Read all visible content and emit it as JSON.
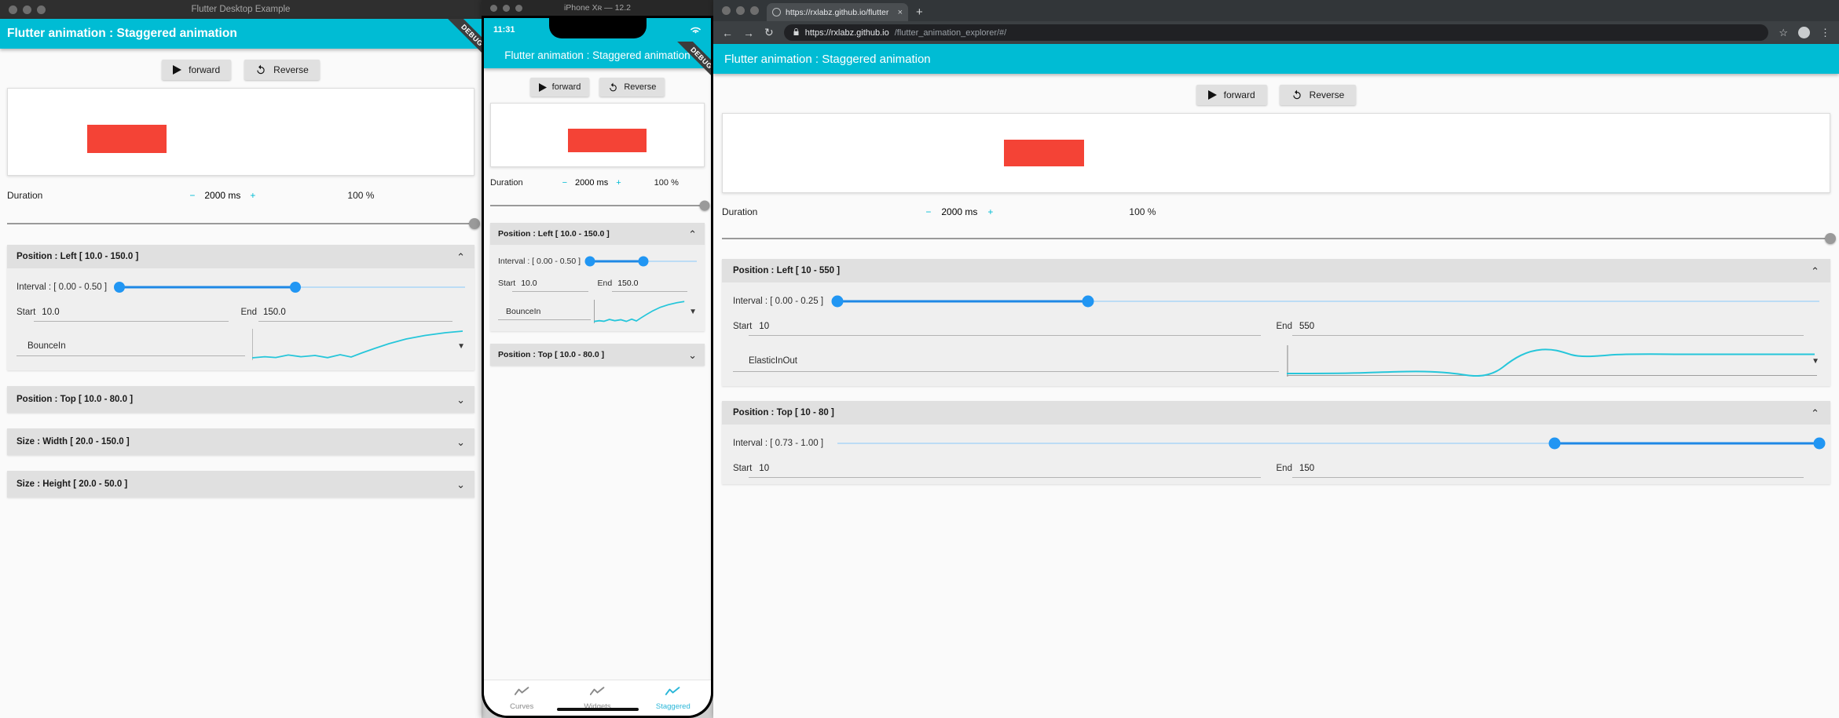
{
  "desktop_window": {
    "title": "Flutter Desktop Example",
    "appbar_title": "Flutter animation : Staggered animation",
    "forward_label": "forward",
    "reverse_label": "Reverse",
    "duration_label": "Duration",
    "duration_value": "2000 ms",
    "percent": "100 %",
    "panels": [
      {
        "title": "Position : Left [ 10.0 - 150.0 ]",
        "expanded": true,
        "chevron": "⌃",
        "interval_label": "Interval : [ 0.00 - 0.50 ]",
        "interval_start": 0.0,
        "interval_end": 0.5,
        "start_label": "Start",
        "start_value": "10.0",
        "end_label": "End",
        "end_value": "150.0",
        "curve": "BounceIn"
      },
      {
        "title": "Position : Top [ 10.0 - 80.0 ]",
        "expanded": false,
        "chevron": "⌄"
      },
      {
        "title": "Size : Width [ 20.0 - 150.0 ]",
        "expanded": false,
        "chevron": "⌄"
      },
      {
        "title": "Size : Height [ 20.0 - 50.0 ]",
        "expanded": false,
        "chevron": "⌄"
      }
    ]
  },
  "phone_window": {
    "title": "iPhone Xʀ — 12.2",
    "status_time": "11:31",
    "appbar_title": "Flutter animation : Staggered animation",
    "debug_ribbon": "DEBUG",
    "forward_label": "forward",
    "reverse_label": "Reverse",
    "duration_label": "Duration",
    "duration_value": "2000 ms",
    "percent": "100 %",
    "panels": [
      {
        "title": "Position : Left [ 10.0 - 150.0 ]",
        "expanded": true,
        "chevron": "⌃",
        "interval_label": "Interval : [ 0.00 - 0.50 ]",
        "interval_start": 0.0,
        "interval_end": 0.5,
        "start_label": "Start",
        "start_value": "10.0",
        "end_label": "End",
        "end_value": "150.0",
        "curve": "BounceIn"
      },
      {
        "title": "Position : Top [ 10.0 - 80.0 ]",
        "expanded": false,
        "chevron": "⌄"
      }
    ],
    "tabs": [
      {
        "label": "Curves",
        "icon": "curve-icon",
        "active": false
      },
      {
        "label": "Widgets",
        "icon": "curve-icon",
        "active": false
      },
      {
        "label": "Staggered",
        "icon": "curve-icon",
        "active": true
      }
    ]
  },
  "chrome_window": {
    "tab_title": "https://rxlabz.github.io/flutter",
    "new_tab_label": "+",
    "close_tab_label": "×",
    "back_icon": "←",
    "forward_icon": "→",
    "reload_icon": "↻",
    "lock_icon": "🔒",
    "url_domain": "https://rxlabz.github.io",
    "url_path": "/flutter_animation_explorer/#/",
    "star_icon": "☆",
    "menu_icon": "⋮",
    "appbar_title": "Flutter animation : Staggered animation",
    "forward_label": "forward",
    "reverse_label": "Reverse",
    "duration_label": "Duration",
    "duration_value": "2000 ms",
    "percent": "100 %",
    "panels": [
      {
        "title": "Position : Left [ 10 - 550 ]",
        "expanded": true,
        "chevron": "⌃",
        "interval_label": "Interval : [ 0.00 - 0.25 ]",
        "interval_start": 0.0,
        "interval_end": 0.25,
        "start_label": "Start",
        "start_value": "10",
        "end_label": "End",
        "end_value": "550",
        "curve": "ElasticInOut"
      },
      {
        "title": "Position : Top [ 10 - 80 ]",
        "expanded": true,
        "chevron": "⌃",
        "interval_label": "Interval : [ 0.73 - 1.00 ]",
        "interval_start": 0.73,
        "interval_end": 1.0,
        "start_label": "Start",
        "start_value": "10",
        "end_label": "End",
        "end_value": "150",
        "curve": ""
      }
    ]
  },
  "colors": {
    "accent": "#00bcd4",
    "box": "#f44336",
    "slider": "#2196f3",
    "curve": "#26c6da"
  }
}
